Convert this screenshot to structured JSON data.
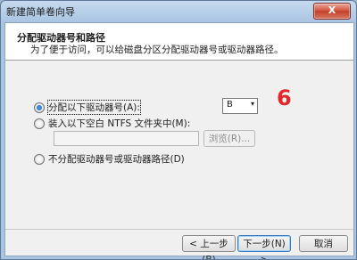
{
  "window": {
    "title": "新建简单卷向导",
    "close_label": "X"
  },
  "header": {
    "title": "分配驱动器号和路径",
    "subtitle": "为了便于访问，可以给磁盘分区分配驱动器号或驱动器路径。"
  },
  "options": {
    "assign_letter": "分配以下驱动器号(A):",
    "mount_folder": "装入以下空白 NTFS 文件夹中(M):",
    "no_assign": "不分配驱动器号或驱动器路径(D)"
  },
  "drive_letter": {
    "value": "B",
    "arrow": "▾"
  },
  "mount_path": {
    "value": ""
  },
  "browse_button": "浏览(R)...",
  "annotation_number": "6",
  "footer": {
    "back": "< 上一步(B)",
    "next": "下一步(N) >",
    "cancel": "取消"
  }
}
